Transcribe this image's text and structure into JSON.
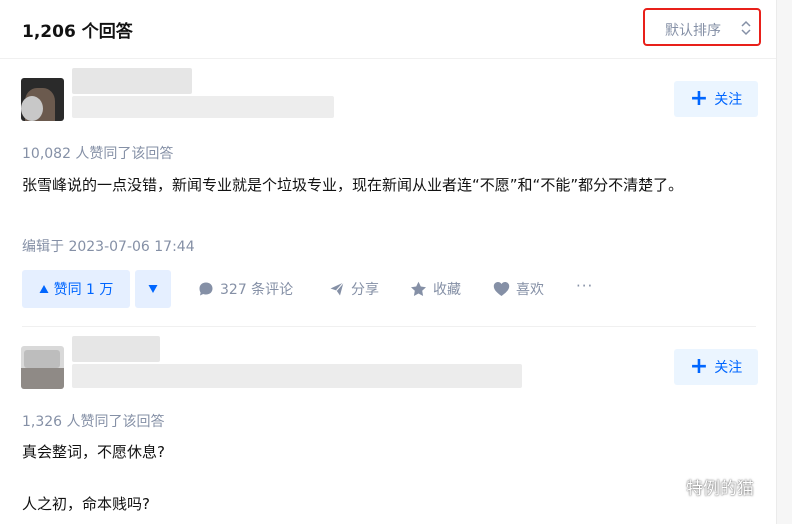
{
  "header": {
    "answer_count": "1,206 个回答",
    "sort_label": "默认排序"
  },
  "answers": [
    {
      "follow_label": "关注",
      "upvote_summary": "10,082 人赞同了该回答",
      "content": "张雪峰说的一点没错，新闻专业就是个垃圾专业，现在新闻从业者连“不愿”和“不能”都分不清楚了。",
      "edited": "编辑于 2023-07-06 17:44",
      "actions": {
        "vote_up": "赞同 1 万",
        "comments": "327 条评论",
        "share": "分享",
        "favorite": "收藏",
        "like": "喜欢",
        "more": "···"
      }
    },
    {
      "follow_label": "关注",
      "upvote_summary": "1,326 人赞同了该回答",
      "content_line1": "真会整词，不愿休息?",
      "content_line2": "人之初，命本贱吗?"
    }
  ],
  "watermark": {
    "text": "特例的猫"
  },
  "colors": {
    "accent": "#0066ff",
    "highlight_border": "#e8201a",
    "meta": "#8590a6"
  }
}
